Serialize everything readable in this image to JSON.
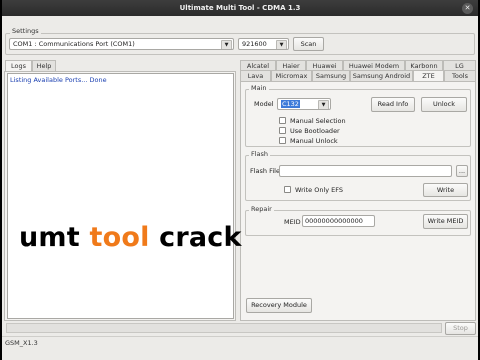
{
  "window": {
    "title": "Ultimate Multi Tool - CDMA 1.3",
    "close_glyph": "✕"
  },
  "settings": {
    "legend": "Settings",
    "port_value": "COM1 : Communications Port (COM1)",
    "baud_value": "921600",
    "scan_label": "Scan"
  },
  "left_tabs": [
    "Logs",
    "Help"
  ],
  "log_text": "Listing Available Ports... Done",
  "brand_tabs_row1": [
    "Alcatel",
    "Haier",
    "Huawei",
    "Huawei Modem",
    "Karbonn",
    "LG"
  ],
  "brand_tabs_row2": [
    "Lava",
    "Micromax",
    "Samsung",
    "Samsung Android",
    "ZTE",
    "Tools"
  ],
  "main": {
    "legend": "Main",
    "model_label": "Model",
    "model_value": "C132",
    "read_info_label": "Read Info",
    "unlock_label": "Unlock",
    "checkboxes": [
      "Manual Selection",
      "Use Bootloader",
      "Manual Unlock"
    ]
  },
  "flash": {
    "legend": "Flash",
    "file_label": "Flash File",
    "browse_label": "...",
    "write_only_efs_label": "Write Only EFS",
    "write_label": "Write"
  },
  "repair": {
    "legend": "Repair",
    "meid_label": "MEID",
    "meid_value": "00000000000000",
    "write_meid_label": "Write MEID"
  },
  "recovery_label": "Recovery Module",
  "stop_label": "Stop",
  "status_text": "GSM_X1.3",
  "overlay": {
    "part1": "umt ",
    "part2": "tool",
    "part3": " crack"
  },
  "colors": {
    "overlay_black": "#000000",
    "overlay_orange": "#f07a1a",
    "log_text": "#1a3fb0",
    "selection": "#3d7bd9"
  }
}
